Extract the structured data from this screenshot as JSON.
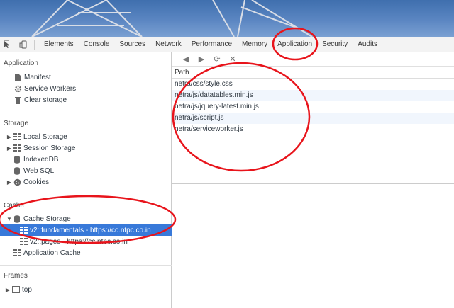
{
  "toolbar": {
    "tabs": [
      {
        "label": "Elements"
      },
      {
        "label": "Console"
      },
      {
        "label": "Sources"
      },
      {
        "label": "Network"
      },
      {
        "label": "Performance"
      },
      {
        "label": "Memory"
      },
      {
        "label": "Application"
      },
      {
        "label": "Security"
      },
      {
        "label": "Audits"
      }
    ],
    "active_tab": "Application"
  },
  "sidebar": {
    "application": {
      "title": "Application",
      "items": [
        {
          "label": "Manifest",
          "icon": "document-icon"
        },
        {
          "label": "Service Workers",
          "icon": "gear-icon"
        },
        {
          "label": "Clear storage",
          "icon": "trash-icon"
        }
      ]
    },
    "storage": {
      "title": "Storage",
      "items": [
        {
          "label": "Local Storage",
          "icon": "grid-icon",
          "expandable": true
        },
        {
          "label": "Session Storage",
          "icon": "grid-icon",
          "expandable": true
        },
        {
          "label": "IndexedDB",
          "icon": "database-icon"
        },
        {
          "label": "Web SQL",
          "icon": "database-icon"
        },
        {
          "label": "Cookies",
          "icon": "cookie-icon",
          "expandable": true
        }
      ]
    },
    "cache": {
      "title": "Cache",
      "cache_storage": {
        "label": "Cache Storage",
        "expanded": true
      },
      "entries": [
        {
          "label": "v2::fundamentals - https://cc.ntpc.co.in",
          "selected": true
        },
        {
          "label": "v2::pages - https://cc.ntpc.co.in",
          "selected": false
        }
      ],
      "app_cache": {
        "label": "Application Cache"
      }
    },
    "frames": {
      "title": "Frames",
      "top": {
        "label": "top"
      }
    }
  },
  "main": {
    "column_header": "Path",
    "rows": [
      "netra/css/style.css",
      "netra/js/datatables.min.js",
      "netra/js/jquery-latest.min.js",
      "netra/js/script.js",
      "netra/serviceworker.js"
    ]
  },
  "colors": {
    "selection": "#3879d9",
    "annotation": "#e8141b",
    "row_alt": "#f1f6fd"
  }
}
